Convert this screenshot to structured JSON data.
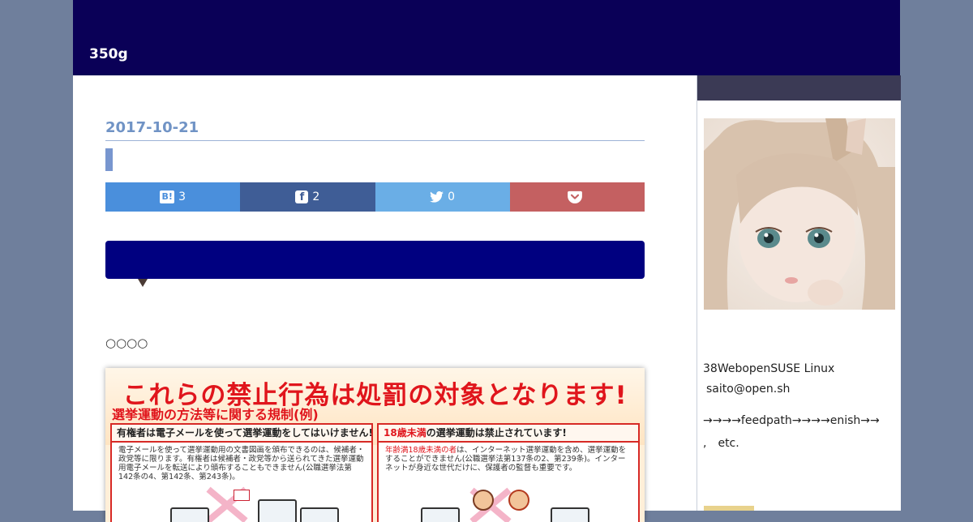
{
  "site": {
    "title": "350g"
  },
  "post": {
    "date": "2017-10-21",
    "title": "",
    "share": {
      "hatena_icon": "B!",
      "hatena_count": "3",
      "facebook_icon": "f",
      "facebook_count": "2",
      "twitter_count": "0"
    },
    "circles_text": "○○○○",
    "figure": {
      "title": "これらの禁止行為は処罰の対象となります!",
      "subtitle": "選挙運動の方法等に関する規制(例)",
      "left_box_title": "有権者は電子メールを使って選挙運動をしてはいけません!",
      "left_box_text": "電子メールを使って選挙運動用の文書図画を頒布できるのは、候補者・政党等に限ります。有権者は候補者・政党等から送られてきた選挙運動用電子メールを転送により頒布することもできません(公職選挙法第142条の4、第142条、第243条)。",
      "right_box_title_red": "18歳未満",
      "right_box_title_rest": "の選挙運動は禁止されています!",
      "right_box_text_red": "年齢満18歳未満の者",
      "right_box_text_rest": "は、インターネット選挙運動を含め、選挙運動をすることができません(公職選挙法第137条の2、第239条)。インターネットが身近な世代だけに、保護者の監督も重要です。"
    }
  },
  "sidebar": {
    "profile_line1": "38WebopenSUSE Linux",
    "profile_line2": "saito@open.sh",
    "profile_line3": "→→→→feedpath→→→→enish→→",
    "profile_line4": ",　etc."
  },
  "colors": {
    "header": "#0a0057",
    "accent": "#7093c5",
    "hatena": "#4a8fdc",
    "facebook": "#3f5d96",
    "twitter": "#6aaee6",
    "pocket": "#c46061",
    "balloon": "#000080"
  }
}
